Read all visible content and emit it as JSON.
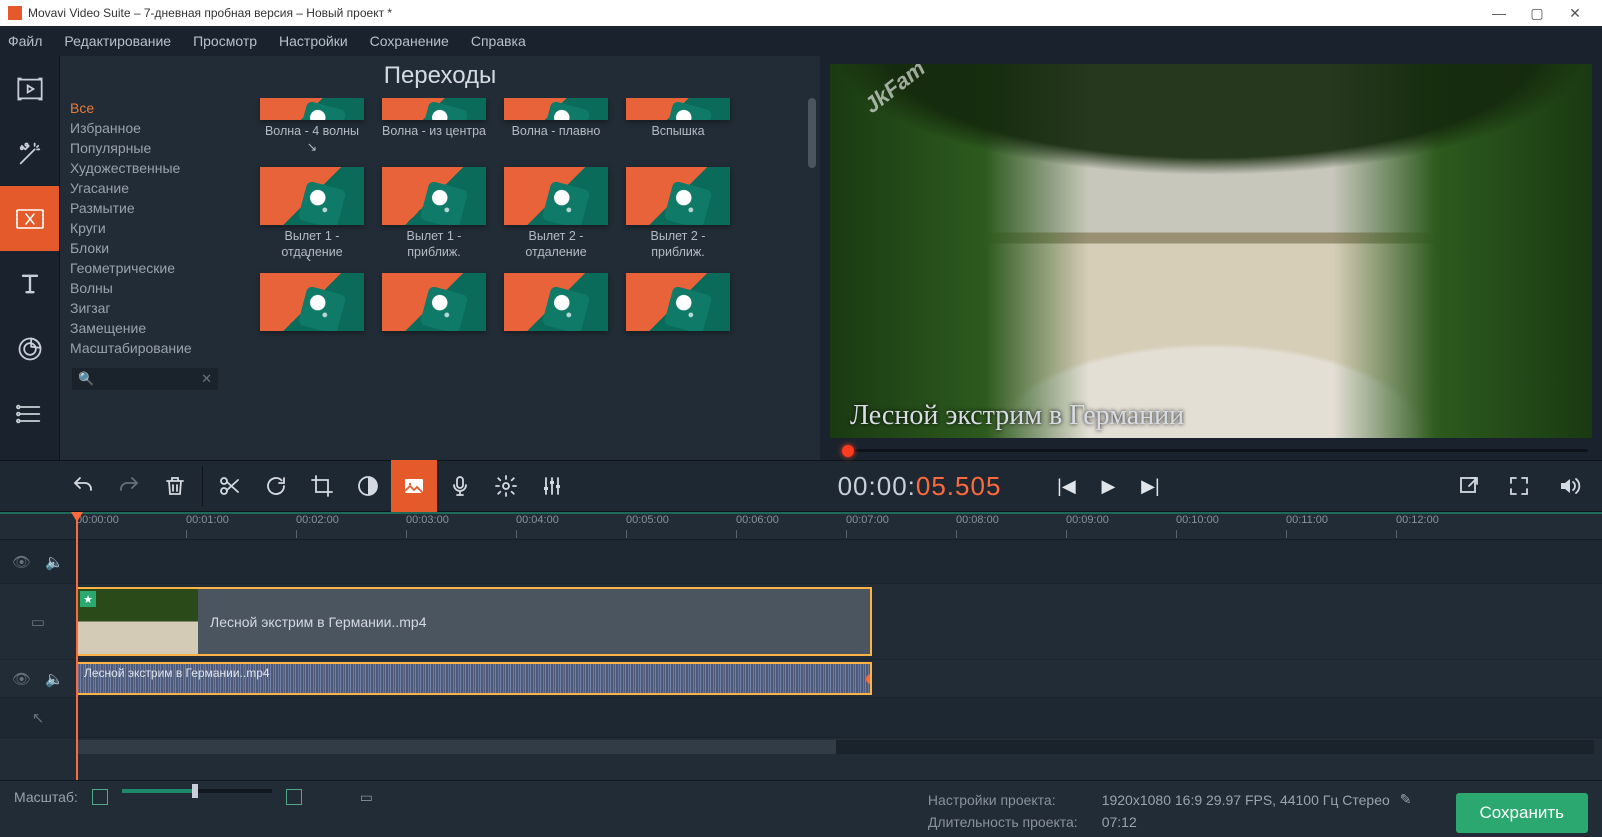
{
  "window": {
    "title": "Movavi Video Suite – 7-дневная пробная версия – Новый проект *"
  },
  "menu": [
    "Файл",
    "Редактирование",
    "Просмотр",
    "Настройки",
    "Сохранение",
    "Справка"
  ],
  "panel": {
    "title": "Переходы",
    "categories": [
      "Все",
      "Избранное",
      "Популярные",
      "Художественные",
      "Угасание",
      "Размытие",
      "Круги",
      "Блоки",
      "Геометрические",
      "Волны",
      "Зигзаг",
      "Замещение",
      "Масштабирование"
    ],
    "selected_category": 0,
    "items": [
      {
        "label": "Волна - 4 волны ↘"
      },
      {
        "label": "Волна - из центра"
      },
      {
        "label": "Волна - плавно"
      },
      {
        "label": "Вспышка"
      },
      {
        "label": "Вылет 1 - отдаление"
      },
      {
        "label": "Вылет 1 - приближ."
      },
      {
        "label": "Вылет 2 - отдаление"
      },
      {
        "label": "Вылет 2 - приближ."
      }
    ]
  },
  "preview": {
    "watermark": "JkFam",
    "overlay_text": "Лесной экстрим в Германии",
    "timecode_prefix": "00:00:",
    "timecode_hot": "05.505"
  },
  "timeline": {
    "ruler": [
      "00:00:00",
      "00:01:00",
      "00:02:00",
      "00:03:00",
      "00:04:00",
      "00:05:00",
      "00:06:00",
      "00:07:00",
      "00:08:00",
      "00:09:00",
      "00:10:00",
      "00:11:00",
      "00:12:00"
    ],
    "video_clip": "Лесной экстрим в Германии..mp4",
    "audio_clip": "Лесной экстрим в Германии..mp4"
  },
  "status": {
    "zoom_label": "Масштаб:",
    "settings_label": "Настройки проекта:",
    "settings_value": "1920x1080 16:9 29.97 FPS, 44100 Гц Стерео",
    "duration_label": "Длительность проекта:",
    "duration_value": "07:12",
    "export": "Сохранить"
  }
}
